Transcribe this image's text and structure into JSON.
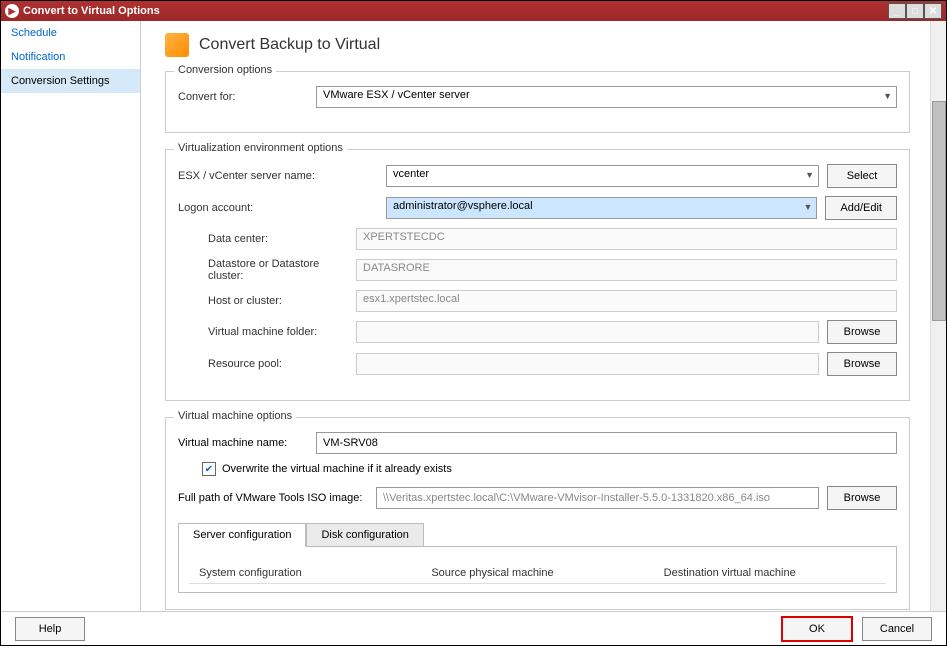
{
  "window": {
    "title": "Convert to Virtual Options"
  },
  "sidebar": {
    "items": [
      {
        "label": "Schedule"
      },
      {
        "label": "Notification"
      },
      {
        "label": "Conversion Settings"
      }
    ]
  },
  "page": {
    "title": "Convert Backup to Virtual"
  },
  "conversion_options": {
    "legend": "Conversion options",
    "convert_for_label": "Convert for:",
    "convert_for_value": "VMware ESX / vCenter server"
  },
  "virt_env": {
    "legend": "Virtualization environment options",
    "server_label": "ESX / vCenter server name:",
    "server_value": "vcenter",
    "select_btn": "Select",
    "logon_label": "Logon account:",
    "logon_value": "administrator@vsphere.local",
    "addedit_btn": "Add/Edit",
    "datacenter_label": "Data center:",
    "datacenter_value": "XPERTSTECDC",
    "datastore_label": "Datastore or Datastore cluster:",
    "datastore_value": "DATASRORE",
    "host_label": "Host or cluster:",
    "host_value": "esx1.xpertstec.local",
    "vmfolder_label": "Virtual machine folder:",
    "vmfolder_value": "",
    "browse_btn": "Browse",
    "respool_label": "Resource pool:",
    "respool_value": ""
  },
  "vm_options": {
    "legend": "Virtual machine options",
    "vmname_label": "Virtual machine name:",
    "vmname_value": "VM-SRV08",
    "overwrite_label": "Overwrite the virtual machine if it already exists",
    "iso_label": "Full path of VMware Tools ISO image:",
    "iso_value": "\\\\Veritas.xpertstec.local\\C:\\VMware-VMvisor-Installer-5.5.0-1331820.x86_64.iso",
    "browse_btn": "Browse",
    "tabs": [
      {
        "label": "Server configuration"
      },
      {
        "label": "Disk configuration"
      }
    ],
    "table_headers": [
      "System configuration",
      "Source physical machine",
      "Destination virtual machine"
    ]
  },
  "footer": {
    "help": "Help",
    "ok": "OK",
    "cancel": "Cancel"
  }
}
